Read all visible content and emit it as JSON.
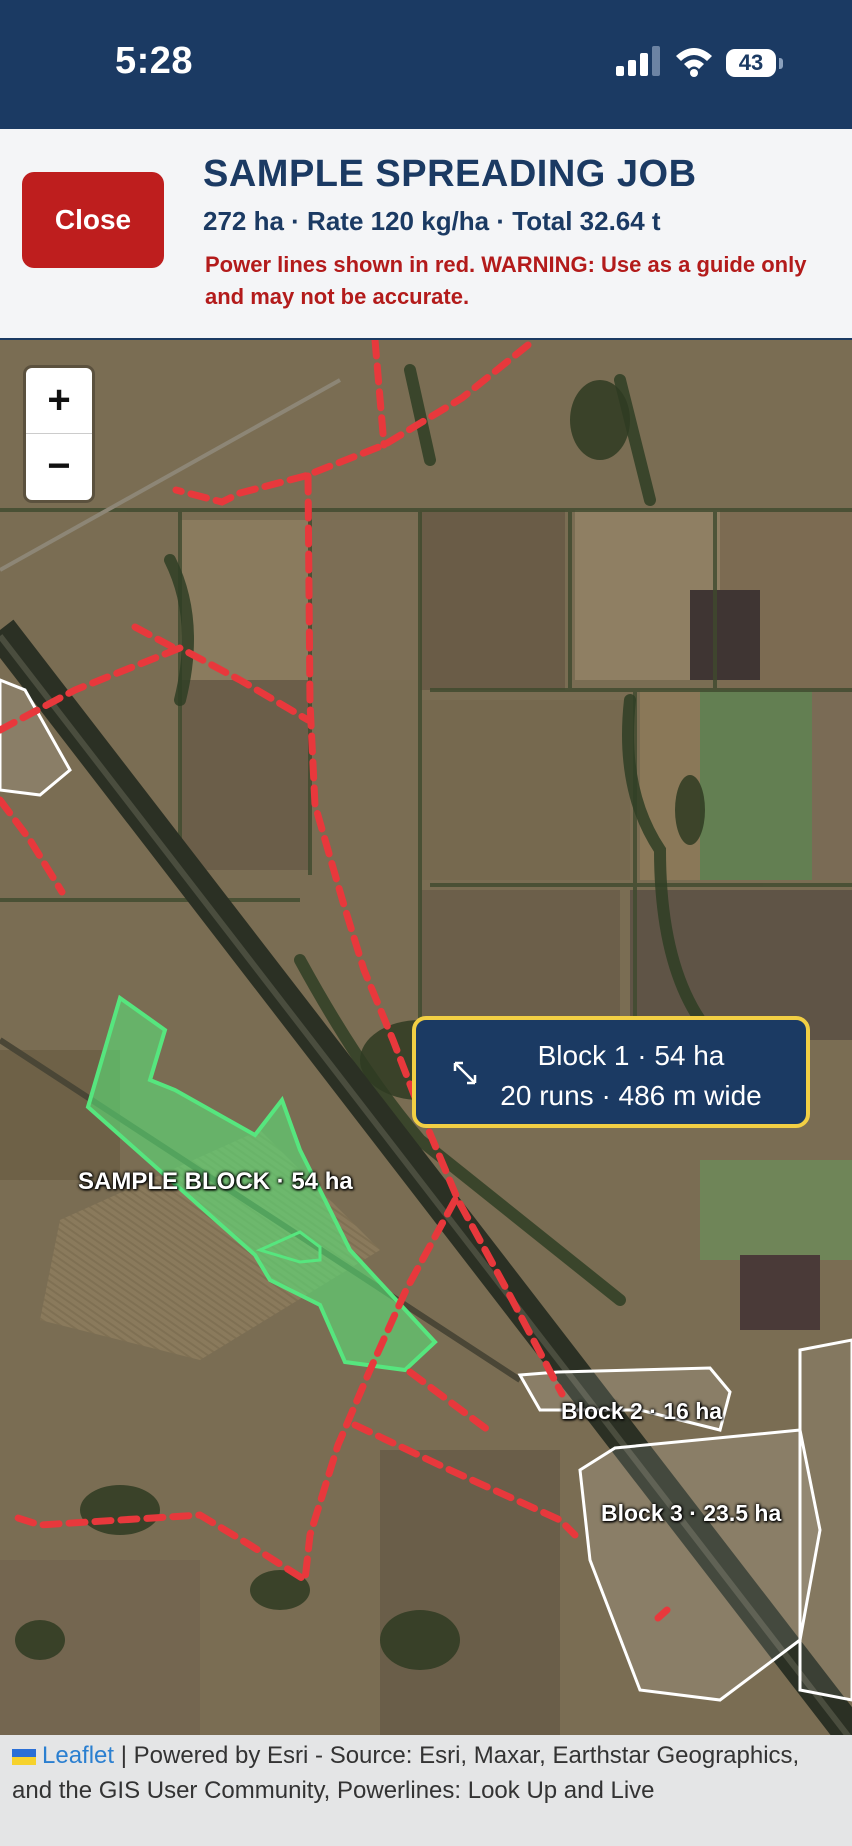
{
  "status_bar": {
    "time": "5:28",
    "battery": "43",
    "icons": [
      "cellular-signal-icon",
      "wifi-icon",
      "battery-icon"
    ]
  },
  "header": {
    "close_label": "Close",
    "title": "SAMPLE SPREADING JOB",
    "stats": "272 ha · Rate 120 kg/ha · Total 32.64 t",
    "warning": "Power lines shown in red. WARNING: Use as a guide only and may not be accurate."
  },
  "map": {
    "zoom_in": "+",
    "zoom_out": "−",
    "tooltip": {
      "line1": "Block 1 · 54 ha",
      "line2": "20 runs · 486 m wide",
      "icon": "resize-arrows-icon"
    },
    "labels": {
      "sample_block": "SAMPLE BLOCK · 54 ha",
      "block2": "Block 2 · 16 ha",
      "block3": "Block 3 · 23.5 ha"
    },
    "colors": {
      "power_lines": "#e8383c",
      "selected_block": "#4ee07a",
      "block_outline": "#ffffff",
      "tooltip_bg": "#1b3a63",
      "tooltip_border": "#f2cf44"
    }
  },
  "attribution": {
    "leaflet": "Leaflet",
    "text": " | Powered by Esri - Source: Esri, Maxar, Earthstar Geographics, and the GIS User Community, Powerlines: Look Up and Live"
  }
}
